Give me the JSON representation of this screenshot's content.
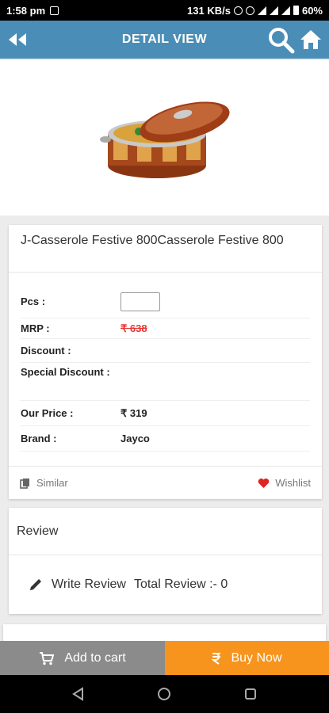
{
  "status_bar": {
    "time": "1:58 pm",
    "speed": "131 KB/s",
    "battery": "60%"
  },
  "appbar": {
    "title": "DETAIL VIEW",
    "back_icon": "double-chevron-left-icon",
    "search_icon": "search-icon",
    "home_icon": "home-icon",
    "color": "#4a8db7"
  },
  "product": {
    "name": "J-Casserole Festive 800Casserole Festive 800",
    "details": {
      "pcs_label": "Pcs :",
      "pcs_value": "",
      "mrp_label": "MRP :",
      "mrp_value": "₹ 638",
      "discount_label": "Discount :",
      "discount_value": "",
      "special_discount_label": "Special Discount :",
      "special_discount_value": "",
      "our_price_label": "Our Price :",
      "our_price_value": "₹ 319",
      "brand_label": "Brand :",
      "brand_value": "Jayco"
    },
    "actions": {
      "similar_label": "Similar",
      "wishlist_label": "Wishlist"
    }
  },
  "review": {
    "title": "Review",
    "write_label": "Write Review",
    "total_label": "Total Review :- 0"
  },
  "bottom_bar": {
    "add_to_cart": "Add to cart",
    "buy_now": "Buy Now",
    "cart_color": "#8b8b8b",
    "buy_color": "#f7941d"
  }
}
